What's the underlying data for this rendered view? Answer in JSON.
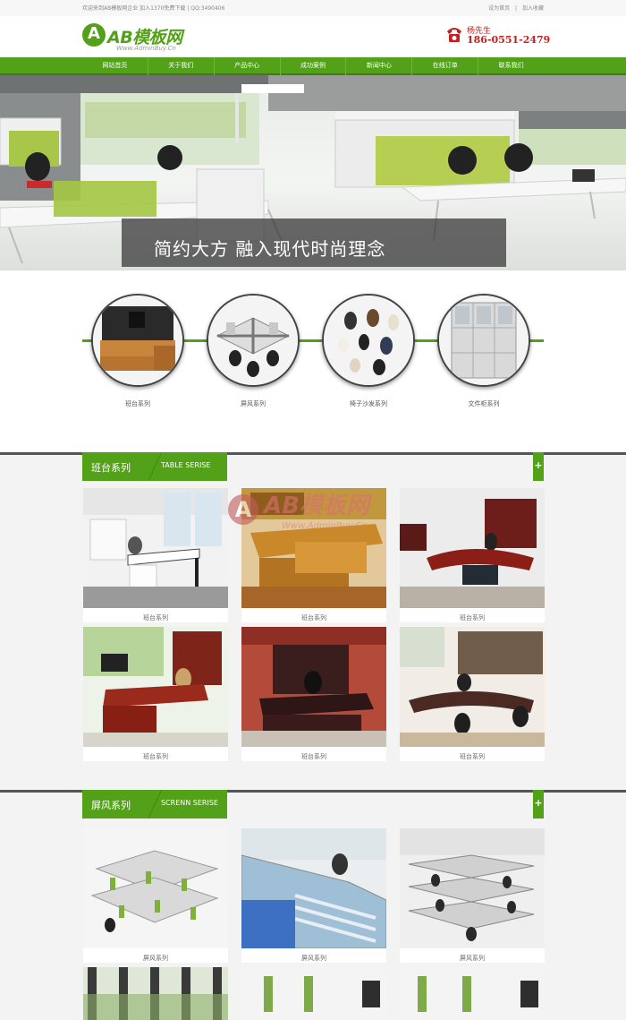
{
  "topbar": {
    "welcome": "欢迎来到AB模板网企业 加入1370免费下载 | QQ:3490406",
    "links": [
      "设为首页",
      "加入收藏"
    ]
  },
  "logo": {
    "mark": "A",
    "text": "AB模板网",
    "url": "Www.AdminBuy.Cn"
  },
  "contact": {
    "name": "杨先生",
    "phone": "186-0551-2479"
  },
  "nav": {
    "items": [
      "网站首页",
      "关于我们",
      "产品中心",
      "成功案例",
      "新闻中心",
      "在线订单",
      "联系我们"
    ]
  },
  "banner": {
    "caption": "简约大方  融入现代时尚理念"
  },
  "categories": [
    {
      "label": "班台系列"
    },
    {
      "label": "屏风系列"
    },
    {
      "label": "椅子沙发系列"
    },
    {
      "label": "文件柜系列"
    }
  ],
  "sections": [
    {
      "title_cn": "班台系列",
      "title_en": "TABLE SERISE",
      "more": "+",
      "items": [
        "班台系列",
        "班台系列",
        "班台系列",
        "班台系列",
        "班台系列",
        "班台系列"
      ]
    },
    {
      "title_cn": "屏风系列",
      "title_en": "SCRENN SERISE",
      "more": "+",
      "items": [
        "屏风系列",
        "屏风系列",
        "屏风系列"
      ]
    }
  ],
  "watermark": {
    "text": "AB模板网",
    "url": "Www.AdminBuy.Cn"
  },
  "colors": {
    "brand_green": "#52a118",
    "phone_red": "#c52020"
  }
}
